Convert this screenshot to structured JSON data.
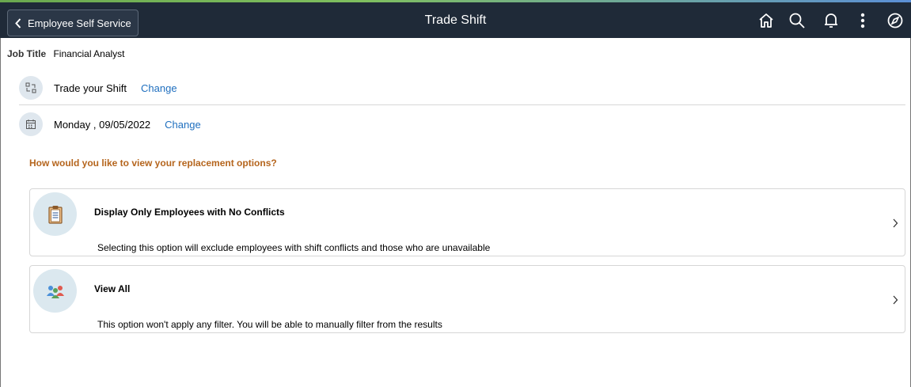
{
  "header": {
    "back_label": "Employee Self Service",
    "title": "Trade Shift",
    "icons": [
      "home-icon",
      "search-icon",
      "bell-icon",
      "more-vertical-icon",
      "compass-icon"
    ]
  },
  "job": {
    "label": "Job Title",
    "value": "Financial Analyst"
  },
  "shift_row": {
    "icon": "trade-shift-icon",
    "text": "Trade your Shift",
    "link": "Change"
  },
  "date_row": {
    "icon": "calendar-icon",
    "text": "Monday , 09/05/2022",
    "link": "Change"
  },
  "question": "How would you like to view your replacement options?",
  "options": [
    {
      "icon": "clipboard-icon",
      "title": "Display Only Employees with No Conflicts",
      "description": "Selecting this option will exclude employees with shift conflicts and those who are unavailable"
    },
    {
      "icon": "people-icon",
      "title": "View All",
      "description": "This option won't apply any filter. You will be able to manually filter from the results"
    }
  ],
  "colors": {
    "header_bg": "#1f2a38",
    "link": "#1f6fbf",
    "question": "#b5651d",
    "icon_circle": "#dbe8ef"
  }
}
